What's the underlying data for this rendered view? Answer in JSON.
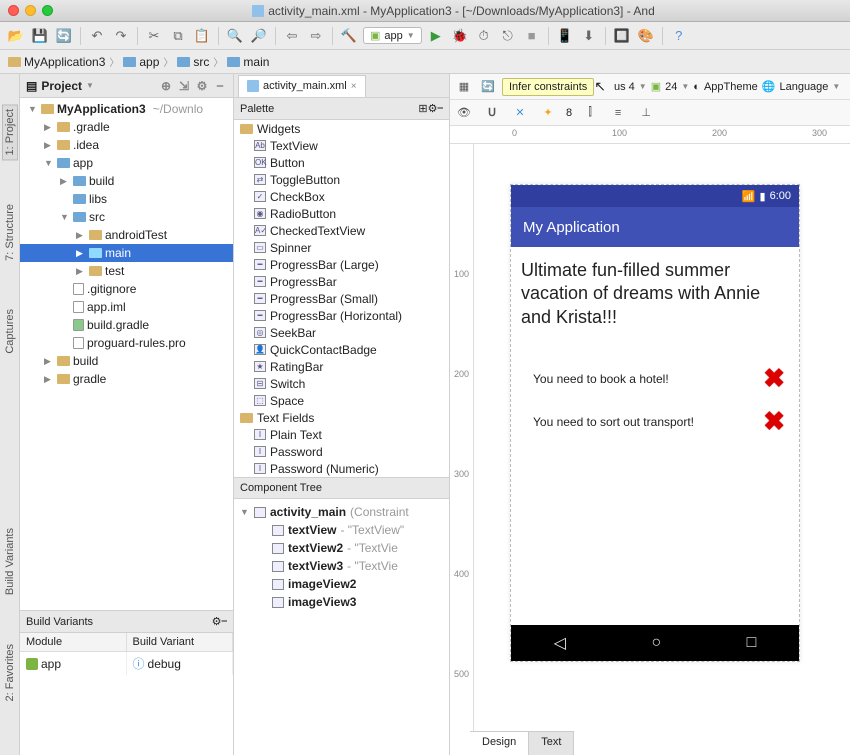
{
  "window": {
    "title": "activity_main.xml - MyApplication3 - [~/Downloads/MyApplication3] - And"
  },
  "app_selector": "app",
  "breadcrumb": [
    {
      "icon": "project",
      "label": "MyApplication3"
    },
    {
      "icon": "pkg",
      "label": "app"
    },
    {
      "icon": "pkg",
      "label": "src"
    },
    {
      "icon": "pkg",
      "label": "main"
    }
  ],
  "rails": {
    "left": [
      "1: Project",
      "7: Structure",
      "Captures"
    ],
    "left_bottom": [
      "Build Variants",
      "2: Favorites"
    ]
  },
  "project_panel": {
    "title": "Project",
    "root": {
      "label": "MyApplication3",
      "hint": "~/Downlo"
    },
    "nodes": [
      {
        "indent": 1,
        "arrow": "▶",
        "icon": "folder",
        "label": ".gradle"
      },
      {
        "indent": 1,
        "arrow": "▶",
        "icon": "folder",
        "label": ".idea"
      },
      {
        "indent": 1,
        "arrow": "▼",
        "icon": "pkg",
        "label": "app"
      },
      {
        "indent": 2,
        "arrow": "▶",
        "icon": "pkg",
        "label": "build"
      },
      {
        "indent": 2,
        "arrow": "",
        "icon": "pkg",
        "label": "libs"
      },
      {
        "indent": 2,
        "arrow": "▼",
        "icon": "pkg",
        "label": "src"
      },
      {
        "indent": 3,
        "arrow": "▶",
        "icon": "folder",
        "label": "androidTest"
      },
      {
        "indent": 3,
        "arrow": "▶",
        "icon": "pkg",
        "label": "main",
        "selected": true
      },
      {
        "indent": 3,
        "arrow": "▶",
        "icon": "folder",
        "label": "test"
      },
      {
        "indent": 2,
        "arrow": "",
        "icon": "file",
        "label": ".gitignore"
      },
      {
        "indent": 2,
        "arrow": "",
        "icon": "file",
        "label": "app.iml"
      },
      {
        "indent": 2,
        "arrow": "",
        "icon": "grd",
        "label": "build.gradle"
      },
      {
        "indent": 2,
        "arrow": "",
        "icon": "file",
        "label": "proguard-rules.pro"
      },
      {
        "indent": 1,
        "arrow": "▶",
        "icon": "folder",
        "label": "build"
      },
      {
        "indent": 1,
        "arrow": "▶",
        "icon": "folder",
        "label": "gradle"
      }
    ]
  },
  "build_variants": {
    "title": "Build Variants",
    "columns": [
      "Module",
      "Build Variant"
    ],
    "rows": [
      {
        "module": "app",
        "variant": "debug"
      }
    ]
  },
  "editor_tab": {
    "label": "activity_main.xml"
  },
  "palette": {
    "title": "Palette",
    "groups": [
      {
        "indent": 0,
        "type": "group",
        "label": "Widgets"
      },
      {
        "indent": 1,
        "type": "item",
        "label": "TextView",
        "g": "Ab"
      },
      {
        "indent": 1,
        "type": "item",
        "label": "Button",
        "g": "OK"
      },
      {
        "indent": 1,
        "type": "item",
        "label": "ToggleButton",
        "g": "⇄"
      },
      {
        "indent": 1,
        "type": "item",
        "label": "CheckBox",
        "g": "✓"
      },
      {
        "indent": 1,
        "type": "item",
        "label": "RadioButton",
        "g": "◉"
      },
      {
        "indent": 1,
        "type": "item",
        "label": "CheckedTextView",
        "g": "A✓"
      },
      {
        "indent": 1,
        "type": "item",
        "label": "Spinner",
        "g": "▭"
      },
      {
        "indent": 1,
        "type": "item",
        "label": "ProgressBar (Large)",
        "g": "━"
      },
      {
        "indent": 1,
        "type": "item",
        "label": "ProgressBar",
        "g": "━"
      },
      {
        "indent": 1,
        "type": "item",
        "label": "ProgressBar (Small)",
        "g": "━"
      },
      {
        "indent": 1,
        "type": "item",
        "label": "ProgressBar (Horizontal)",
        "g": "━"
      },
      {
        "indent": 1,
        "type": "item",
        "label": "SeekBar",
        "g": "◎"
      },
      {
        "indent": 1,
        "type": "item",
        "label": "QuickContactBadge",
        "g": "👤"
      },
      {
        "indent": 1,
        "type": "item",
        "label": "RatingBar",
        "g": "★"
      },
      {
        "indent": 1,
        "type": "item",
        "label": "Switch",
        "g": "⊟"
      },
      {
        "indent": 1,
        "type": "item",
        "label": "Space",
        "g": "⬚"
      },
      {
        "indent": 0,
        "type": "group",
        "label": "Text Fields"
      },
      {
        "indent": 1,
        "type": "item",
        "label": "Plain Text",
        "g": "I"
      },
      {
        "indent": 1,
        "type": "item",
        "label": "Password",
        "g": "I"
      },
      {
        "indent": 1,
        "type": "item",
        "label": "Password (Numeric)",
        "g": "I"
      }
    ]
  },
  "component_tree": {
    "title": "Component Tree",
    "rows": [
      {
        "indent": 0,
        "arrow": "▼",
        "bold": "activity_main",
        "hint": "(Constraint"
      },
      {
        "indent": 1,
        "arrow": "",
        "bold": "textView",
        "hint": "- \"TextView\""
      },
      {
        "indent": 1,
        "arrow": "",
        "bold": "textView2",
        "hint": "- \"TextVie"
      },
      {
        "indent": 1,
        "arrow": "",
        "bold": "textView3",
        "hint": "- \"TextVie"
      },
      {
        "indent": 1,
        "arrow": "",
        "bold": "imageView2",
        "hint": ""
      },
      {
        "indent": 1,
        "arrow": "",
        "bold": "imageView3",
        "hint": ""
      }
    ]
  },
  "design_bar": {
    "tooltip": "Infer constraints",
    "device": "us 4",
    "api": "24",
    "theme": "AppTheme",
    "language": "Language",
    "pack": "8"
  },
  "ruler_h": [
    "0",
    "100",
    "200",
    "300"
  ],
  "ruler_v": [
    "100",
    "200",
    "300",
    "400",
    "500"
  ],
  "preview": {
    "status_time": "6:00",
    "appbar_title": "My Application",
    "heading": "Ultimate fun-filled summer vacation of dreams with Annie and Krista!!!",
    "tasks": [
      "You need to book a hotel!",
      "You need to sort out transport!"
    ]
  },
  "bottom_tabs": [
    "Design",
    "Text"
  ]
}
